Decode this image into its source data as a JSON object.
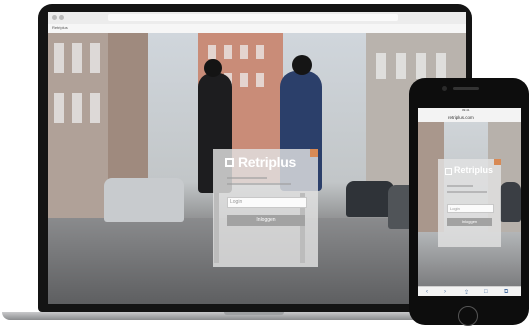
{
  "laptop": {
    "tab_label": "Retriplus",
    "login": {
      "brand": "Retriplus",
      "field_placeholder": "Login",
      "submit_label": "Inloggen"
    }
  },
  "phone": {
    "status": "09:41",
    "url": "retriplus.com",
    "login": {
      "brand": "Retriplus",
      "field_placeholder": "Login",
      "submit_label": "Inloggen"
    },
    "toolbar": {
      "back": "‹",
      "forward": "›",
      "share": "⇪",
      "bookmarks": "□",
      "tabs": "⧉"
    }
  },
  "colors": {
    "accent": "#d88a55",
    "panel": "#e2e2e2",
    "button": "#a2a2a2",
    "device": "#141414"
  }
}
